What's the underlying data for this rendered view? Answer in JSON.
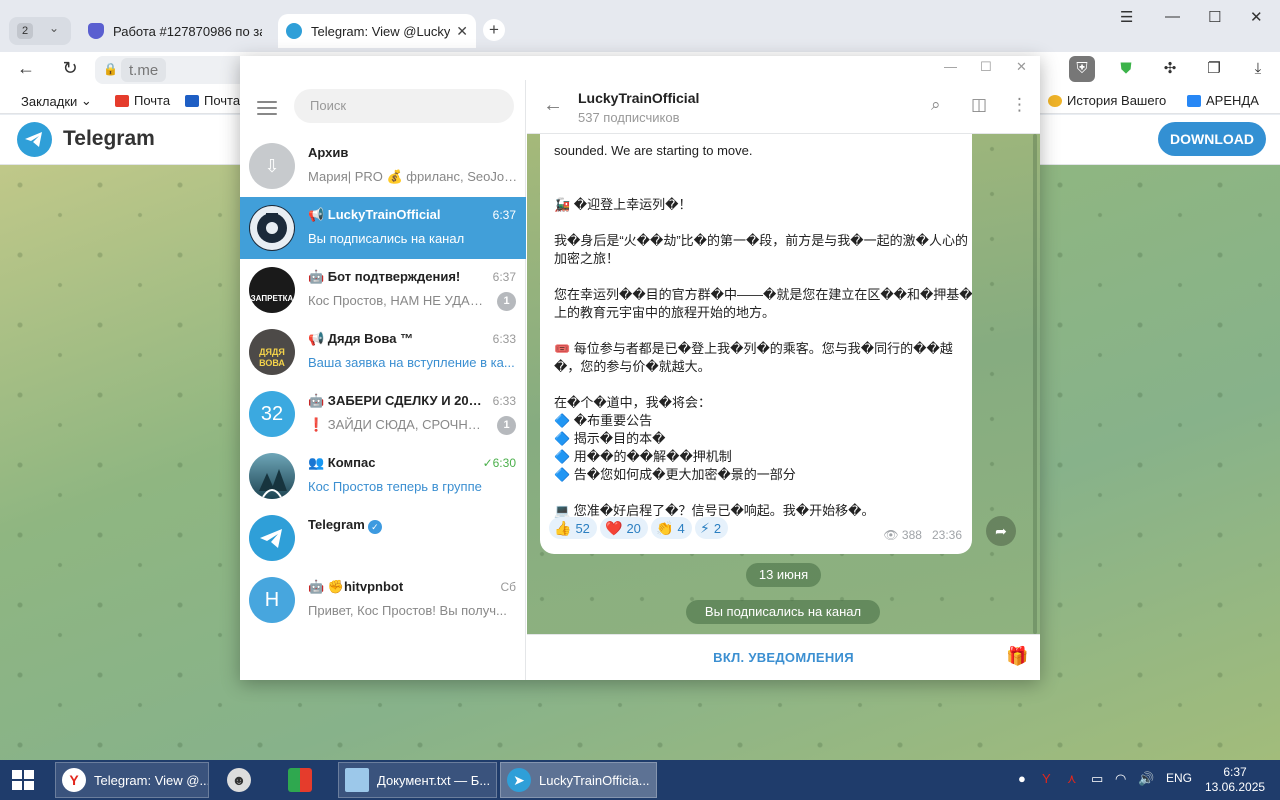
{
  "browser": {
    "tab_count": "2",
    "tabs": [
      {
        "title": "Работа #127870986 по за",
        "active": false
      },
      {
        "title": "Telegram: View @Lucky",
        "active": true
      }
    ],
    "url": "t.me",
    "bookmarks": [
      "Закладки",
      "Почта",
      "Почта",
      "История Вашего",
      "АРЕНДА"
    ]
  },
  "page": {
    "brand": "Telegram",
    "download_label": "DOWNLOAD"
  },
  "sidebar": {
    "search_placeholder": "Поиск",
    "chats": [
      {
        "name": "Архив",
        "time": "",
        "message": "Мария| PRO 💰 фриланс, SeoJob...",
        "badge": "",
        "avatar_color": "#c7cacd",
        "avatar_text": ""
      },
      {
        "name": "📢 LuckyTrainOfficial",
        "time": "6:37",
        "message": "Вы подписались на канал",
        "badge": "",
        "avatar_color": "#1b2a3a",
        "avatar_text": ""
      },
      {
        "name": "🤖 Бот подтверждения!",
        "time": "6:37",
        "message": "Кос Простов, НАМ НЕ УДАЛ...",
        "badge": "1",
        "avatar_color": "#1a1a1a",
        "avatar_text": "ЗАПРЕТКА"
      },
      {
        "name": "📢 Дядя Вова ™",
        "time": "6:33",
        "message": "Ваша заявка на вступление в ка...",
        "badge": "",
        "avatar_color": "#4d4a48",
        "avatar_text": "ДЯДЯ ВОВА"
      },
      {
        "name": "🤖 ЗАБЕРИ СДЕЛКУ И 200$...",
        "time": "6:33",
        "message": "❗ ЗАЙДИ СЮДА, СРОЧНО ...",
        "badge": "1",
        "avatar_color": "#3ba9e0",
        "avatar_text": "32"
      },
      {
        "name": "👥 Компас",
        "time": "✓6:30",
        "message": "Кос Простов теперь в группе",
        "badge": "",
        "avatar_color": "#2d5b6b",
        "avatar_text": ""
      },
      {
        "name": "Telegram",
        "time": "",
        "message": "",
        "badge": "",
        "avatar_color": "#2f9fd8",
        "avatar_text": ""
      },
      {
        "name": "🤖 ✊hitvpnbot",
        "time": "Сб",
        "message": "Привет, Кос Простов!  Вы получ...",
        "badge": "",
        "avatar_color": "#47a6de",
        "avatar_text": "H"
      }
    ]
  },
  "channel": {
    "title": "LuckyTrainOfficial",
    "subtitle": "537 подписчиков",
    "post_lines": [
      "sounded. We are starting to move.",
      "",
      "🚂 �迎登上幸运列�！",
      "",
      "我�身后是“火��劫”比�的第一�段，前方是与我�一起的激�人心的",
      "加密之旅！",
      "",
      "您在幸运列��目的官方群�中——�就是您在建立在区��和�押基�",
      "上的教育元宇宙中的旅程开始的地方。",
      "",
      "🎟️ 每位参与者都是已�登上我�列�的乘客。您与我�同行的��越",
      "�，您的参与价�就越大。",
      "",
      "在�个�道中，我�将会：",
      "🔷 �布重要公告",
      "🔷 揭示�目的本�",
      "🔷 用��的��解��押机制",
      "🔷 告�您如何成�更大加密�景的一部分",
      "",
      "💻 您准�好启程了�？信号已�响起。我�开始移�。"
    ],
    "reactions": [
      {
        "emoji": "👍",
        "count": "52"
      },
      {
        "emoji": "❤️",
        "count": "20"
      },
      {
        "emoji": "👏",
        "count": "4"
      },
      {
        "emoji": "⚡",
        "count": "2"
      }
    ],
    "views": "388",
    "post_time": "23:36",
    "date_chip": "13 июня",
    "service_msg": "Вы подписались на канал",
    "notif_button": "ВКЛ. УВЕДОМЛЕНИЯ"
  },
  "taskbar": {
    "apps": [
      {
        "title": "Telegram: View @..."
      },
      {
        "title": ""
      },
      {
        "title": ""
      },
      {
        "title": "Документ.txt — Б..."
      },
      {
        "title": "LuckyTrainOfficia..."
      }
    ],
    "lang": "ENG",
    "time": "6:37",
    "date": "13.06.2025"
  }
}
